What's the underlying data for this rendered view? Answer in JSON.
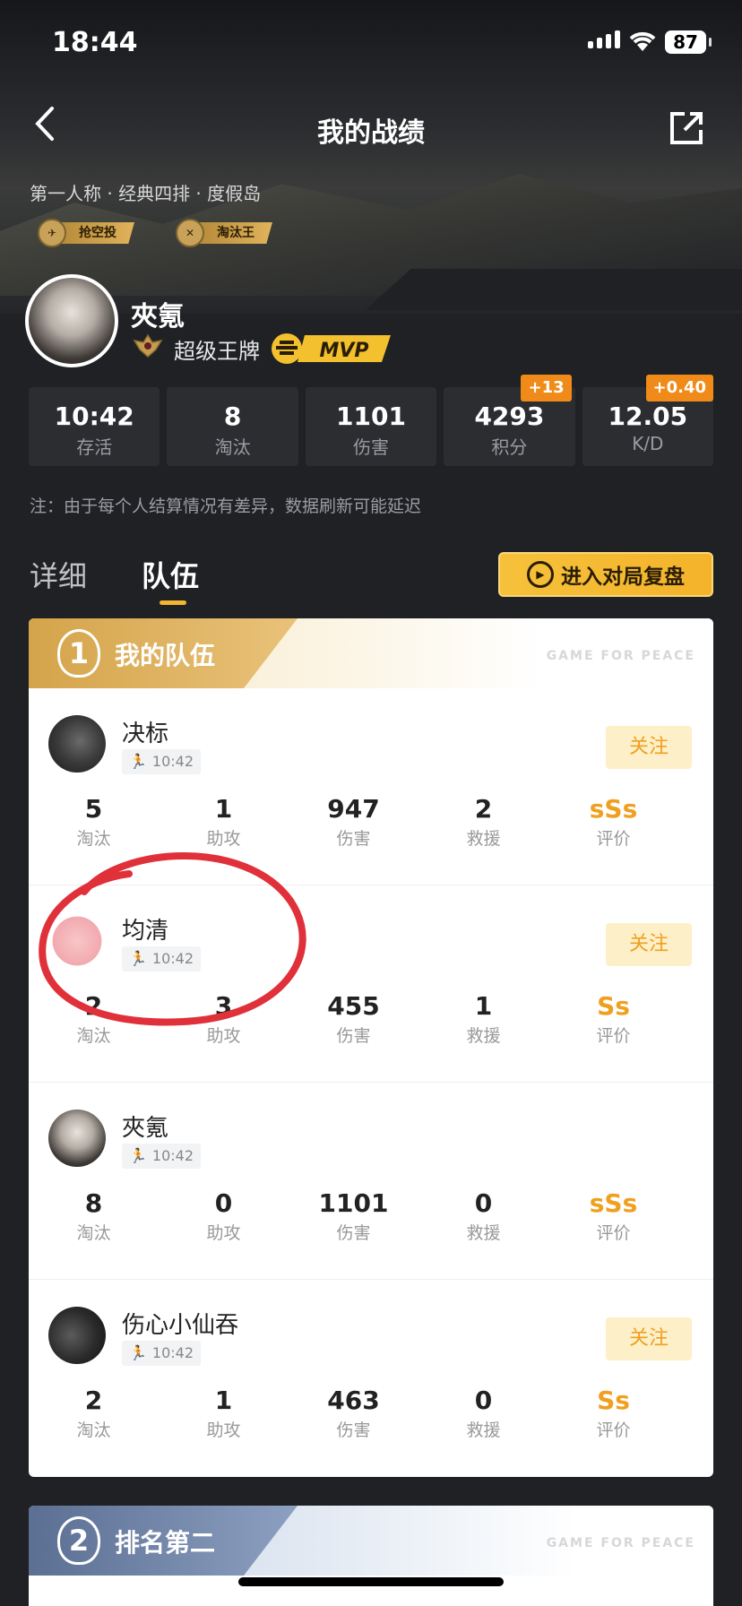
{
  "status_bar": {
    "time": "18:44",
    "battery": "87"
  },
  "nav": {
    "title": "我的战绩"
  },
  "match": {
    "mode": "第一人称 · 经典四排 · 度假岛",
    "badges": [
      {
        "icon": "airdrop",
        "label": "抢空投"
      },
      {
        "icon": "elimination",
        "label": "淘汰王"
      }
    ]
  },
  "player": {
    "name": "夾氪",
    "rank": "超级王牌",
    "mvp": "MVP"
  },
  "stats": [
    {
      "value": "10:42",
      "label": "存活",
      "plus": ""
    },
    {
      "value": "8",
      "label": "淘汰",
      "plus": ""
    },
    {
      "value": "1101",
      "label": "伤害",
      "plus": ""
    },
    {
      "value": "4293",
      "label": "积分",
      "plus": "+13"
    },
    {
      "value": "12.05",
      "label": "K/D",
      "plus": "+0.40"
    }
  ],
  "note": "注：由于每个人结算情况有差异，数据刷新可能延迟",
  "tabs": {
    "detail": "详细",
    "team": "队伍"
  },
  "replay_label": "进入对局复盘",
  "teams": [
    {
      "rank": "1",
      "title": "我的队伍",
      "watermark": "GAME FOR PEACE",
      "members": [
        {
          "name": "决标",
          "time": "10:42",
          "follow": "关注",
          "kills": "5",
          "assists": "1",
          "damage": "947",
          "rescues": "2",
          "grade": "sSs"
        },
        {
          "name": "均清",
          "time": "10:42",
          "follow": "关注",
          "kills": "2",
          "assists": "3",
          "damage": "455",
          "rescues": "1",
          "grade": "Ss"
        },
        {
          "name": "夾氪",
          "time": "10:42",
          "follow": "",
          "kills": "8",
          "assists": "0",
          "damage": "1101",
          "rescues": "0",
          "grade": "sSs"
        },
        {
          "name": "伤心小仙吞",
          "time": "10:42",
          "follow": "关注",
          "kills": "2",
          "assists": "1",
          "damage": "463",
          "rescues": "0",
          "grade": "Ss"
        }
      ]
    },
    {
      "rank": "2",
      "title": "排名第二",
      "watermark": "GAME FOR PEACE"
    }
  ],
  "stat_labels": {
    "kills": "淘汰",
    "assists": "助攻",
    "damage": "伤害",
    "rescues": "救援",
    "grade": "评价"
  },
  "colors": {
    "accent": "#f3b62e",
    "grade": "#f0a020",
    "plus_badge": "#f08a18",
    "annotation": "#e0303a"
  }
}
